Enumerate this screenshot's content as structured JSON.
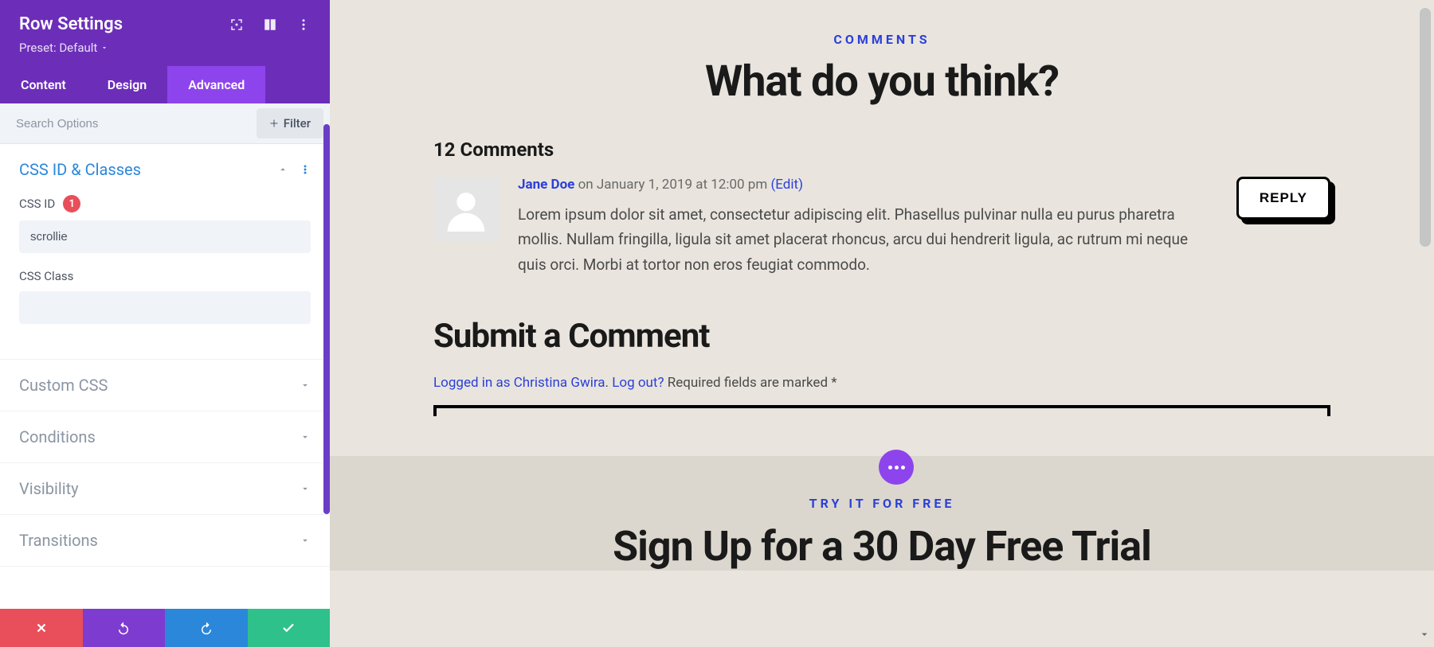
{
  "panel": {
    "title": "Row Settings",
    "preset_label": "Preset: Default"
  },
  "tabs": {
    "content": "Content",
    "design": "Design",
    "advanced": "Advanced"
  },
  "search": {
    "placeholder": "Search Options",
    "filter_label": "Filter"
  },
  "sections": {
    "css_id_classes": {
      "title": "CSS ID & Classes",
      "css_id_label": "CSS ID",
      "css_id_badge": "1",
      "css_id_value": "scrollie",
      "css_class_label": "CSS Class",
      "css_class_value": ""
    },
    "custom_css": "Custom CSS",
    "conditions": "Conditions",
    "visibility": "Visibility",
    "transitions": "Transitions"
  },
  "preview": {
    "comments_label": "COMMENTS",
    "comments_title": "What do you think?",
    "comments_count": "12 Comments",
    "comment": {
      "author": "Jane Doe",
      "date": "on January 1, 2019 at 12:00 pm",
      "edit": "(Edit)",
      "text": "Lorem ipsum dolor sit amet, consectetur adipiscing elit. Phasellus pulvinar nulla eu purus pharetra mollis. Nullam fringilla, ligula sit amet placerat rhoncus, arcu dui hendrerit ligula, ac rutrum mi neque quis orci. Morbi at tortor non eros feugiat commodo.",
      "reply": "REPLY"
    },
    "submit": {
      "title": "Submit a Comment",
      "logged_in": "Logged in as Christina Gwira",
      "logout": "Log out?",
      "required": " Required fields are marked *"
    },
    "trial": {
      "label": "TRY IT FOR FREE",
      "title": "Sign Up for a 30 Day Free Trial"
    }
  }
}
